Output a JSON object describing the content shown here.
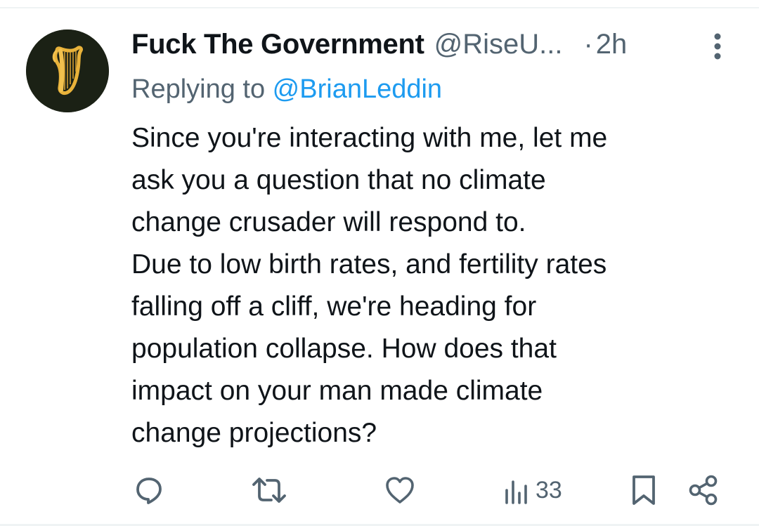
{
  "tweet": {
    "author": {
      "display_name": "Fuck The Government",
      "handle": "@RiseU...",
      "avatar_icon": "harp-icon"
    },
    "separator": "·",
    "time": "2h",
    "reply": {
      "prefix": "Replying to ",
      "mention": "@BrianLeddin"
    },
    "text": "Since you're interacting with me, let me\nask you a question that no climate\nchange crusader will respond to.\nDue to low birth rates, and fertility rates\nfalling off a cliff, we're heading for\npopulation collapse. How does that\nimpact on your man made climate\nchange projections?",
    "actions": {
      "reply_icon": "reply-icon",
      "retweet_icon": "retweet-icon",
      "like_icon": "heart-icon",
      "views_icon": "views-icon",
      "views_count": "33",
      "bookmark_icon": "bookmark-icon",
      "share_icon": "share-icon"
    }
  },
  "colors": {
    "text": "#0f1419",
    "secondary": "#536471",
    "link": "#1d9bf0",
    "avatar_bg": "#1b2115",
    "harp": "#e8b23a"
  }
}
